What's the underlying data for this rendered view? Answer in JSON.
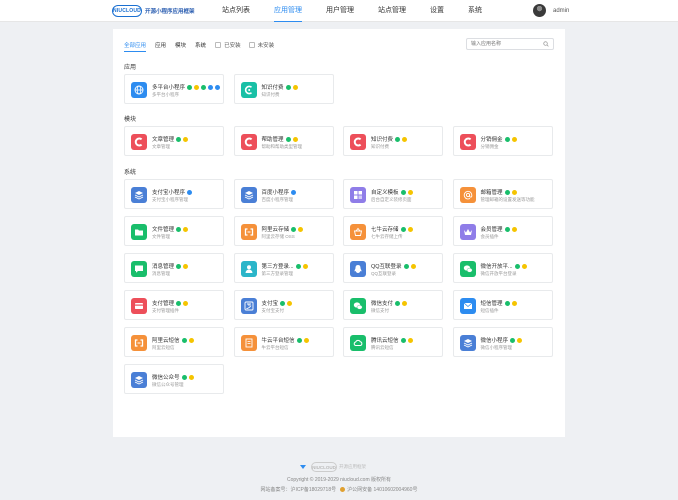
{
  "header": {
    "logo_mark": "NIUCLOUD",
    "logo_text": "开源小程序应用框架",
    "nav": [
      "站点列表",
      "应用管理",
      "用户管理",
      "站点管理",
      "设置",
      "系统"
    ],
    "active_nav": 1,
    "username": "admin"
  },
  "filters": {
    "tabs": [
      "全部应用",
      "应用",
      "模块",
      "系统"
    ],
    "active_tab": 0,
    "checks": [
      "已安装",
      "未安装"
    ],
    "search_placeholder": "输入应用名称"
  },
  "sections": [
    {
      "title": "应用",
      "cards": [
        {
          "name": "多平台小程序",
          "desc": "多平台小程序",
          "icon": "globe-icon",
          "color": "#2d8cf0",
          "badges": [
            "green",
            "yellow",
            "green",
            "blue",
            "blue"
          ]
        },
        {
          "name": "知识付费",
          "desc": "知识付费",
          "icon": "knowledge-icon",
          "color": "#19c0a6",
          "badges": [
            "green",
            "yellow"
          ]
        }
      ]
    },
    {
      "title": "模块",
      "cards": [
        {
          "name": "文章管理",
          "desc": "文章管理",
          "icon": "c-letter-icon",
          "color": "#ed4f5a",
          "badges": [
            "green",
            "yellow"
          ]
        },
        {
          "name": "帮助管理",
          "desc": "帮助和帮助类型管理",
          "icon": "c-letter-icon",
          "color": "#ed4f5a",
          "badges": [
            "green",
            "yellow"
          ]
        },
        {
          "name": "知识付费",
          "desc": "知识付费",
          "icon": "c-letter-icon",
          "color": "#ed4f5a",
          "badges": [
            "green",
            "yellow"
          ]
        },
        {
          "name": "分销佣金",
          "desc": "分销佣金",
          "icon": "c-letter-icon",
          "color": "#ed4f5a",
          "badges": [
            "green",
            "yellow"
          ]
        }
      ]
    },
    {
      "title": "系统",
      "cards": [
        {
          "name": "支付宝小程序",
          "desc": "支付宝小程序管理",
          "icon": "layers-icon",
          "color": "#4a7fd6",
          "badges": [
            "blue"
          ]
        },
        {
          "name": "百度小程序",
          "desc": "百度小程序管理",
          "icon": "layers-icon",
          "color": "#4a7fd6",
          "badges": [
            "blue"
          ]
        },
        {
          "name": "自定义模板",
          "desc": "后台自定义装修页面",
          "icon": "template-icon",
          "color": "#8f7de8",
          "badges": [
            "green",
            "yellow"
          ]
        },
        {
          "name": "邮箱管理",
          "desc": "管理邮箱的设置发送等功能",
          "icon": "at-icon",
          "color": "#f5913a",
          "badges": [
            "green",
            "yellow"
          ]
        },
        {
          "name": "文件管理",
          "desc": "文件管理",
          "icon": "folder-icon",
          "color": "#19be6b",
          "badges": [
            "green",
            "yellow"
          ]
        },
        {
          "name": "阿里云存储",
          "desc": "阿里云存储 OSS",
          "icon": "bracket-icon",
          "color": "#f5913a",
          "badges": [
            "green",
            "yellow"
          ]
        },
        {
          "name": "七牛云存储",
          "desc": "七牛云存储上传",
          "icon": "basket-icon",
          "color": "#f5913a",
          "badges": [
            "green",
            "yellow"
          ]
        },
        {
          "name": "会员管理",
          "desc": "会员插件",
          "icon": "crown-icon",
          "color": "#8f7de8",
          "badges": [
            "green",
            "yellow"
          ]
        },
        {
          "name": "消息管理",
          "desc": "消息管理",
          "icon": "message-icon",
          "color": "#19be6b",
          "badges": [
            "green",
            "yellow"
          ]
        },
        {
          "name": "第三方登录...",
          "desc": "第三方登录管理",
          "icon": "user-icon",
          "color": "#2bb5c9",
          "badges": [
            "green",
            "yellow"
          ]
        },
        {
          "name": "QQ互联登录",
          "desc": "QQ互联登录",
          "icon": "qq-icon",
          "color": "#4a7fd6",
          "badges": [
            "green",
            "yellow"
          ]
        },
        {
          "name": "微信开放平...",
          "desc": "微信开放平台登录",
          "icon": "wechat-icon",
          "color": "#19be6b",
          "badges": [
            "green",
            "yellow"
          ]
        },
        {
          "name": "支付管理",
          "desc": "支付管理插件",
          "icon": "card-icon",
          "color": "#ed4f5a",
          "badges": [
            "green",
            "yellow"
          ]
        },
        {
          "name": "支付宝",
          "desc": "支付宝支付",
          "icon": "alipay-icon",
          "color": "#4a7fd6",
          "badges": [
            "green",
            "yellow"
          ]
        },
        {
          "name": "微信支付",
          "desc": "微信支付",
          "icon": "wechat-icon",
          "color": "#19be6b",
          "badges": [
            "green",
            "yellow"
          ]
        },
        {
          "name": "短信管理",
          "desc": "短信插件",
          "icon": "mail-icon",
          "color": "#2d8cf0",
          "badges": [
            "green",
            "yellow"
          ]
        },
        {
          "name": "阿里云短信",
          "desc": "阿里云短信",
          "icon": "bracket-icon",
          "color": "#f5913a",
          "badges": [
            "green",
            "yellow"
          ]
        },
        {
          "name": "牛云平台短信",
          "desc": "牛云平台短信",
          "icon": "sms-doc-icon",
          "color": "#f5913a",
          "badges": [
            "green",
            "yellow"
          ]
        },
        {
          "name": "腾讯云短信",
          "desc": "腾讯云短信",
          "icon": "cloud-icon",
          "color": "#19be6b",
          "badges": [
            "green",
            "yellow"
          ]
        },
        {
          "name": "微信小程序",
          "desc": "微信小程序管理",
          "icon": "layers-icon",
          "color": "#4a7fd6",
          "badges": [
            "green",
            "yellow"
          ]
        },
        {
          "name": "微信公众号",
          "desc": "微信公众号管理",
          "icon": "layers-icon",
          "color": "#4a7fd6",
          "badges": [
            "green",
            "yellow"
          ]
        }
      ]
    }
  ],
  "footer": {
    "brand_mark": "NIUCLOUD",
    "brand_text": "开源应用框架",
    "copyright": "Copyright © 2019-2029 niucloud.com 版权所有",
    "icp": "网站备案号：沪ICP备18029718号",
    "police": "沪公网安备 14010602004960号"
  }
}
